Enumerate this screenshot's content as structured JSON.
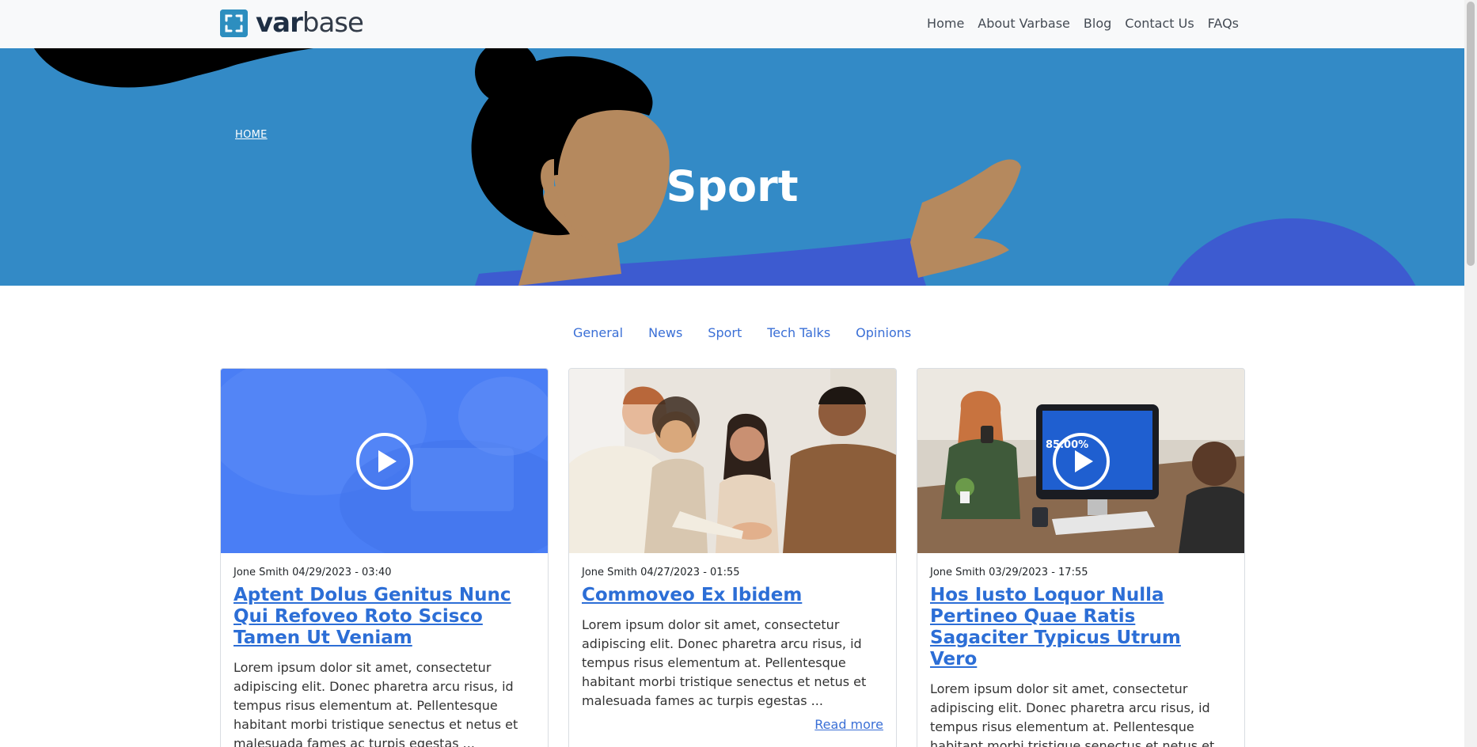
{
  "header": {
    "logo_text_bold": "var",
    "logo_text_light": "base",
    "nav": [
      "Home",
      "About Varbase",
      "Blog",
      "Contact Us",
      "FAQs"
    ]
  },
  "hero": {
    "breadcrumb": "HOME",
    "title": "Sport",
    "bg_color": "#338ac6"
  },
  "tabs": [
    "General",
    "News",
    "Sport",
    "Tech Talks",
    "Opinions"
  ],
  "cards": [
    {
      "meta": "Jone Smith 04/29/2023 - 03:40",
      "title": "Aptent Dolus Genitus Nunc Qui Refoveo Roto Scisco Tamen Ut Veniam",
      "excerpt": "Lorem ipsum dolor sit amet, consectetur adipiscing elit. Donec pharetra arcu risus, id tempus risus elementum at. Pellentesque habitant morbi tristique senectus et netus et malesuada fames ac turpis egestas ...",
      "media": "video",
      "media_icon": "play-icon"
    },
    {
      "meta": "Jone Smith 04/27/2023 - 01:55",
      "title": "Commoveo Ex Ibidem",
      "excerpt": "Lorem ipsum dolor sit amet, consectetur adipiscing elit. Donec pharetra arcu risus, id tempus risus elementum at. Pellentesque habitant morbi tristique senectus et netus et malesuada fames ac turpis egestas ...",
      "read_more": "Read more",
      "media": "image"
    },
    {
      "meta": "Jone Smith 03/29/2023 - 17:55",
      "title": "Hos Iusto Loquor Nulla Pertineo Quae Ratis Sagaciter Typicus Utrum Vero",
      "excerpt": "Lorem ipsum dolor sit amet, consectetur adipiscing elit. Donec pharetra arcu risus, id tempus risus elementum at. Pellentesque habitant morbi tristique senectus et netus et malesuada fames ac turpis egestas ...",
      "media": "video",
      "media_icon": "play-icon",
      "screen_text": "85.00%"
    }
  ],
  "colors": {
    "link": "#2c6ed6",
    "accent_blue": "#3f51d6",
    "video_overlay": "#4a7ef5"
  }
}
